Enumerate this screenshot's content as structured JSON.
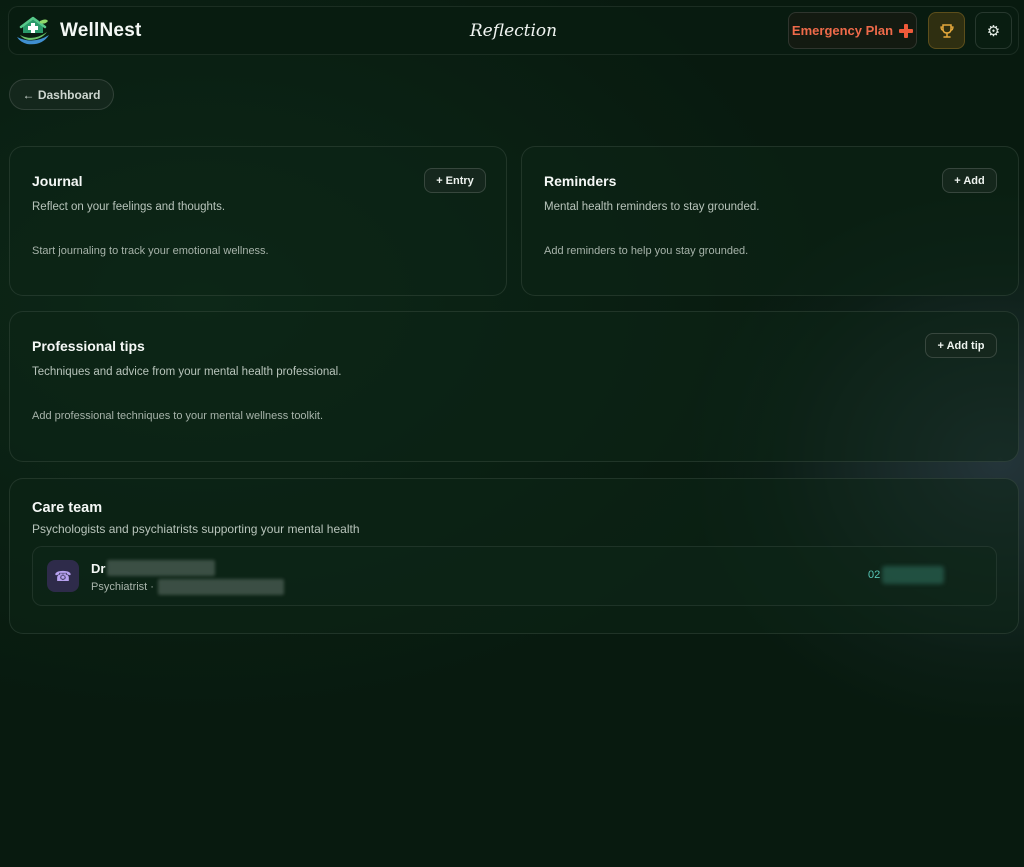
{
  "header": {
    "brand_name": "WellNest",
    "page_title": "Reflection",
    "emergency_label": "Emergency Plan",
    "icons": {
      "logo": "house-leaf-logo",
      "emergency": "plus-icon",
      "trophy": "trophy-icon",
      "settings": "gear-icon"
    }
  },
  "nav": {
    "back_label": "← Dashboard"
  },
  "journal": {
    "title": "Journal",
    "subtitle": "Reflect on your feelings and thoughts.",
    "empty": "Start journaling to track your emotional wellness.",
    "button": "+ Entry"
  },
  "reminders": {
    "title": "Reminders",
    "subtitle": "Mental health reminders to stay grounded.",
    "empty": "Add reminders to help you stay grounded.",
    "button": "+ Add"
  },
  "tips": {
    "title": "Professional tips",
    "subtitle": "Techniques and advice from your mental health professional.",
    "empty": "Add professional techniques to your mental wellness toolkit.",
    "button": "+ Add tip"
  },
  "care_team": {
    "title": "Care team",
    "subtitle": "Psychologists and psychiatrists supporting your mental health",
    "members": [
      {
        "name_prefix": "Dr",
        "role": "Psychiatrist ·",
        "phone_prefix": "02",
        "icon": "phone-icon"
      }
    ]
  },
  "colors": {
    "background": "#081a0f",
    "emergency": "#ee6a4a",
    "trophy": "#e6a93c",
    "phone": "#58c7b8",
    "avatar_bg": "#2e2b4a"
  }
}
